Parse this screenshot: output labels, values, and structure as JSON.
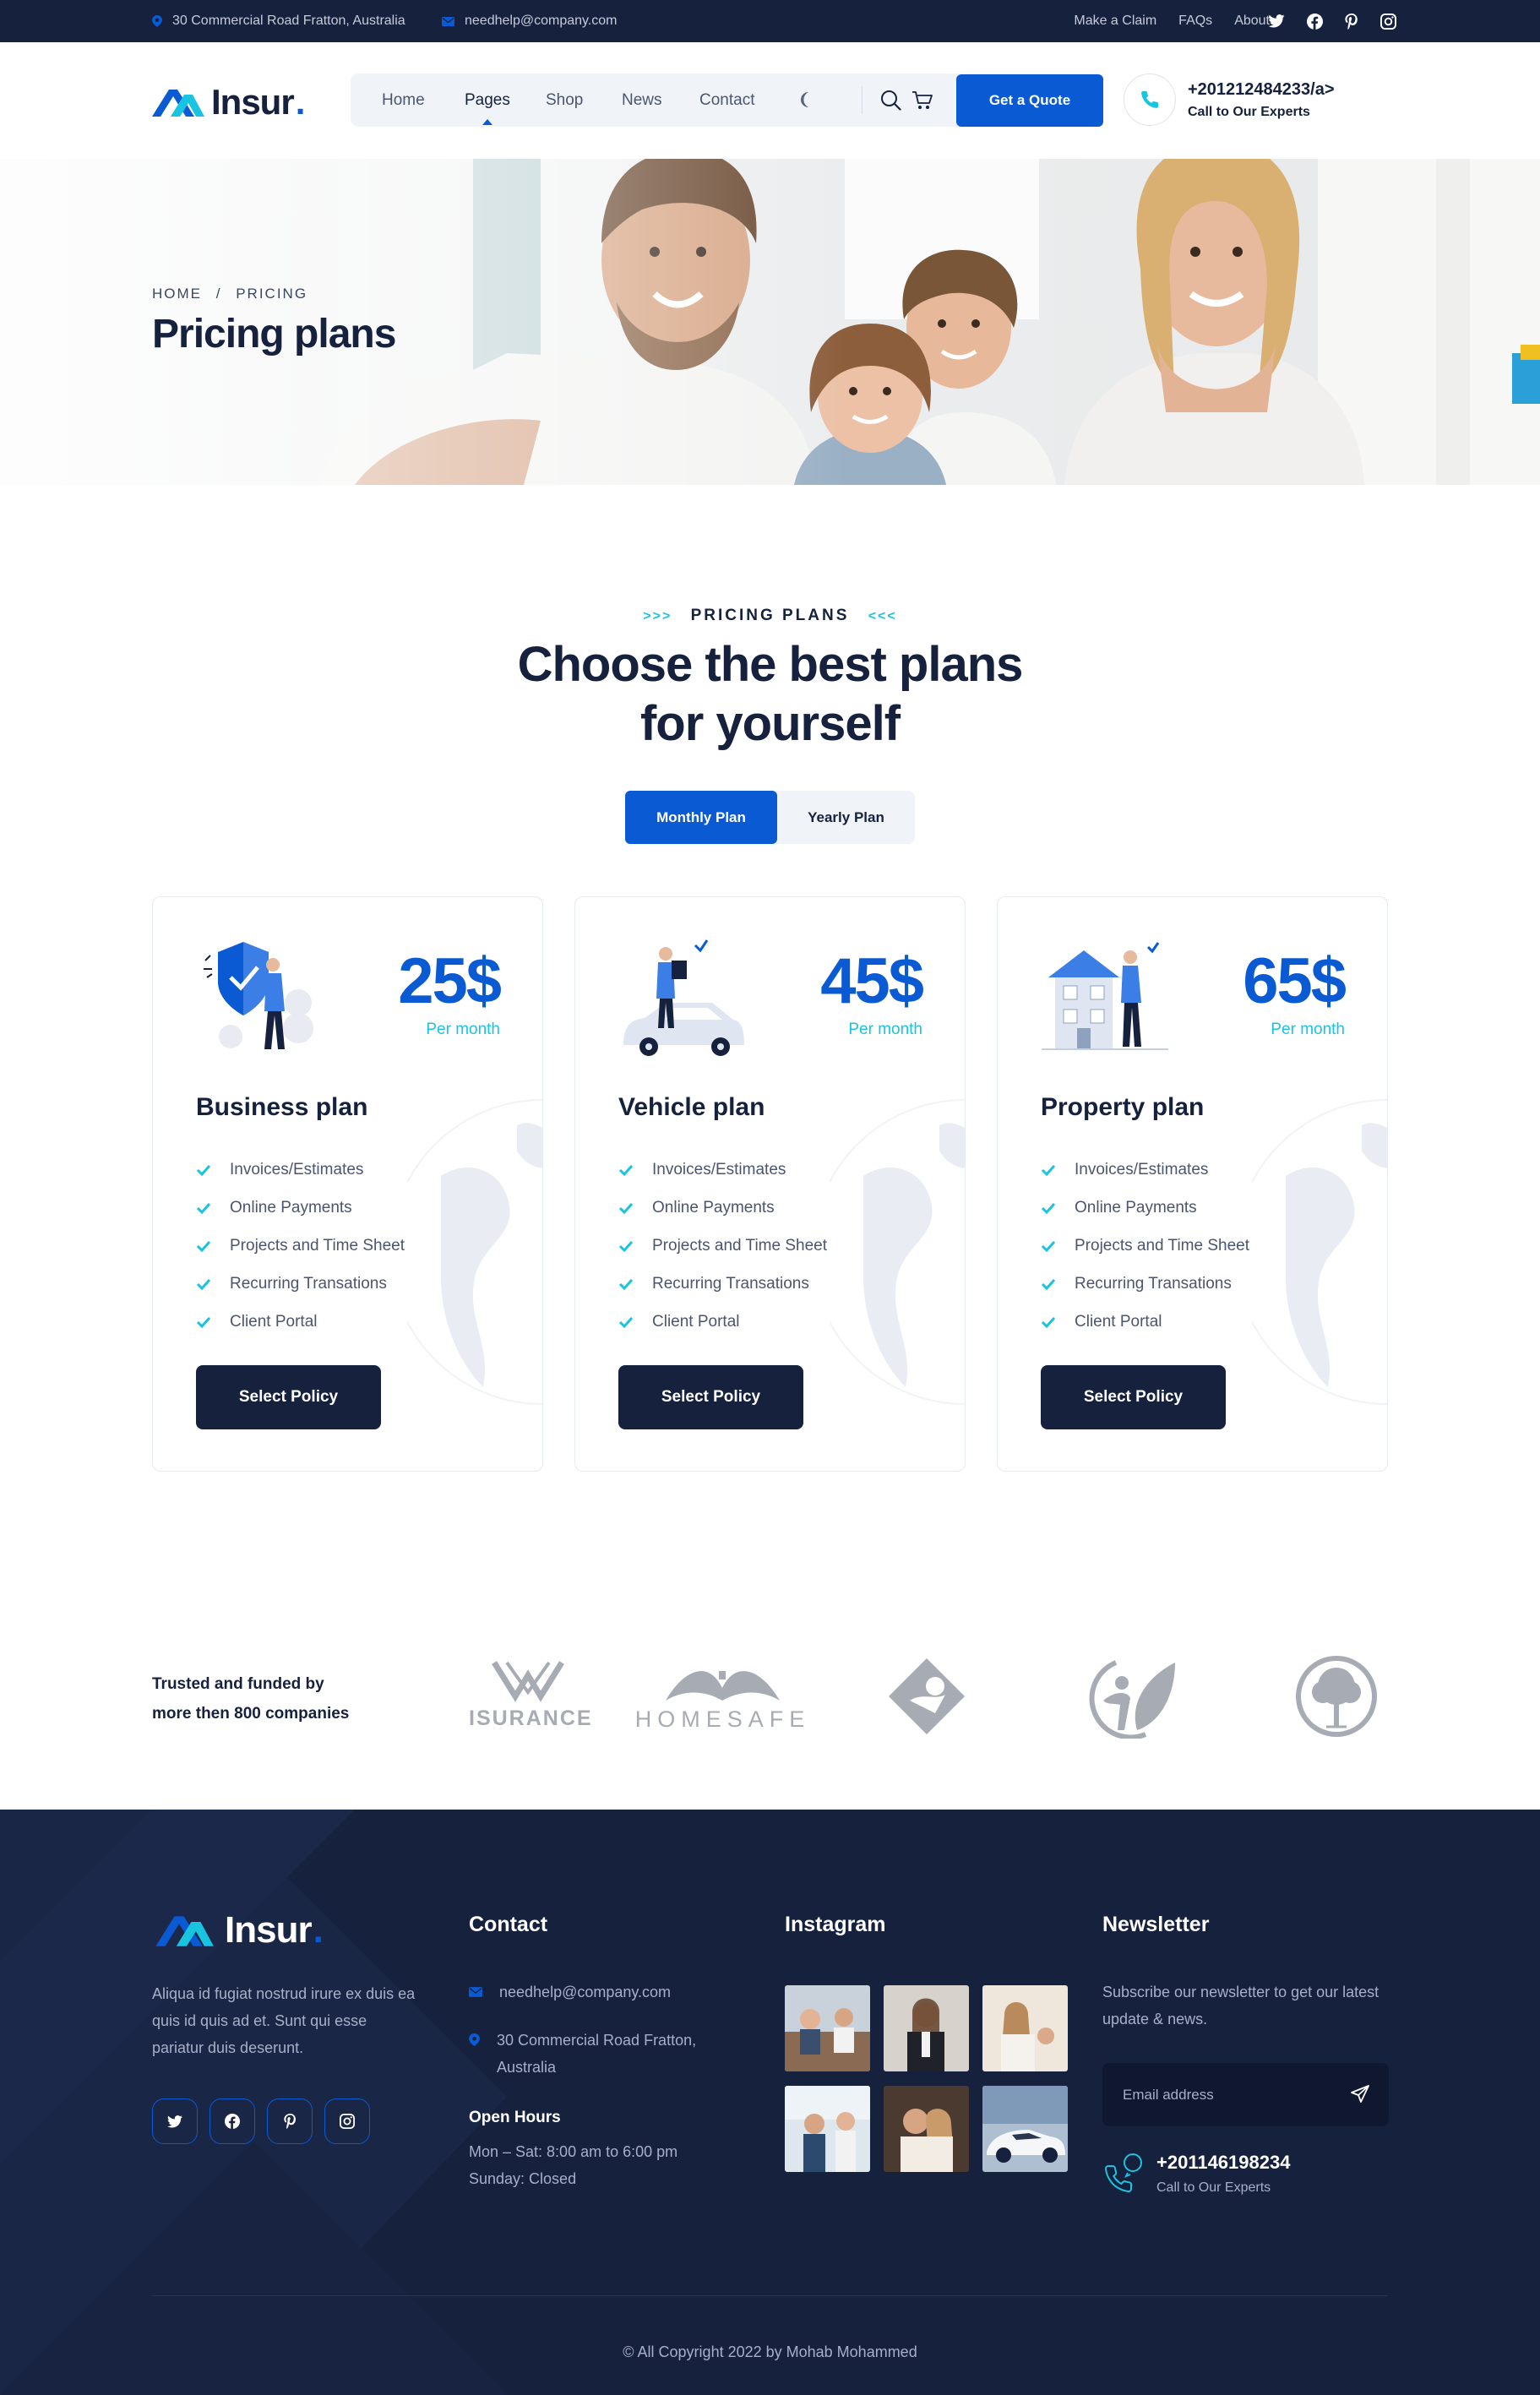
{
  "topbar": {
    "address": "30 Commercial Road Fratton, Australia",
    "email": "needhelp@company.com",
    "links": [
      "Make a Claim",
      "FAQs",
      "About"
    ],
    "social_icons": [
      "twitter-icon",
      "facebook-icon",
      "pinterest-icon",
      "instagram-icon"
    ]
  },
  "header": {
    "logo_word": "Insur",
    "logo_dot": ".",
    "nav": [
      "Home",
      "Pages",
      "Shop",
      "News",
      "Contact"
    ],
    "active_nav": "Pages",
    "quote_button": "Get a Quote",
    "call_phone": "+201212484233/a>",
    "call_label": "Call to Our Experts"
  },
  "hero": {
    "breadcrumb_home": "HOME",
    "breadcrumb_sep": "/",
    "breadcrumb_current": "PRICING",
    "title": "Pricing plans"
  },
  "pricing": {
    "eyebrow_left": ">>>",
    "eyebrow": "PRICING PLANS",
    "eyebrow_right": "<<<",
    "title_line1": "Choose the best plans",
    "title_line2": "for yourself",
    "toggle": {
      "monthly": "Monthly Plan",
      "yearly": "Yearly Plan",
      "selected": "Monthly Plan"
    },
    "cards": [
      {
        "price": "25$",
        "period": "Per month",
        "name": "Business plan",
        "features": [
          "Invoices/Estimates",
          "Online Payments",
          "Projects and Time Sheet",
          "Recurring Transations",
          "Client Portal"
        ],
        "button": "Select Policy"
      },
      {
        "price": "45$",
        "period": "Per month",
        "name": "Vehicle plan",
        "features": [
          "Invoices/Estimates",
          "Online Payments",
          "Projects and Time Sheet",
          "Recurring Transations",
          "Client Portal"
        ],
        "button": "Select Policy"
      },
      {
        "price": "65$",
        "period": "Per month",
        "name": "Property plan",
        "features": [
          "Invoices/Estimates",
          "Online Payments",
          "Projects and Time Sheet",
          "Recurring Transations",
          "Client Portal"
        ],
        "button": "Select Policy"
      }
    ]
  },
  "trusted": {
    "line1": "Trusted and funded by",
    "line2": "more then 800 companies",
    "brands": [
      "ISURANCE",
      "HOMESAFE"
    ]
  },
  "footer": {
    "logo_word": "Insur",
    "logo_dot": ".",
    "about": "Aliqua id fugiat nostrud irure ex duis ea quis id quis ad et. Sunt qui esse pariatur duis deserunt.",
    "contact_heading": "Contact",
    "email": "needhelp@company.com",
    "address": "30 Commercial Road Fratton, Australia",
    "hours_heading": "Open Hours",
    "hours_line1": "Mon – Sat: 8:00 am to 6:00 pm",
    "hours_line2": "Sunday: Closed",
    "instagram_heading": "Instagram",
    "newsletter_heading": "Newsletter",
    "newsletter_text": "Subscribe our newsletter to get our latest update & news.",
    "email_placeholder": "Email address",
    "phone": "+201146198234",
    "phone_label": "Call to Our Experts",
    "copyright": "© All Copyright 2022 by Mohab Mohammed"
  },
  "colors": {
    "navy": "#16213e",
    "brand_blue": "#0a5ad4",
    "accent_cyan": "#19c4e0"
  }
}
